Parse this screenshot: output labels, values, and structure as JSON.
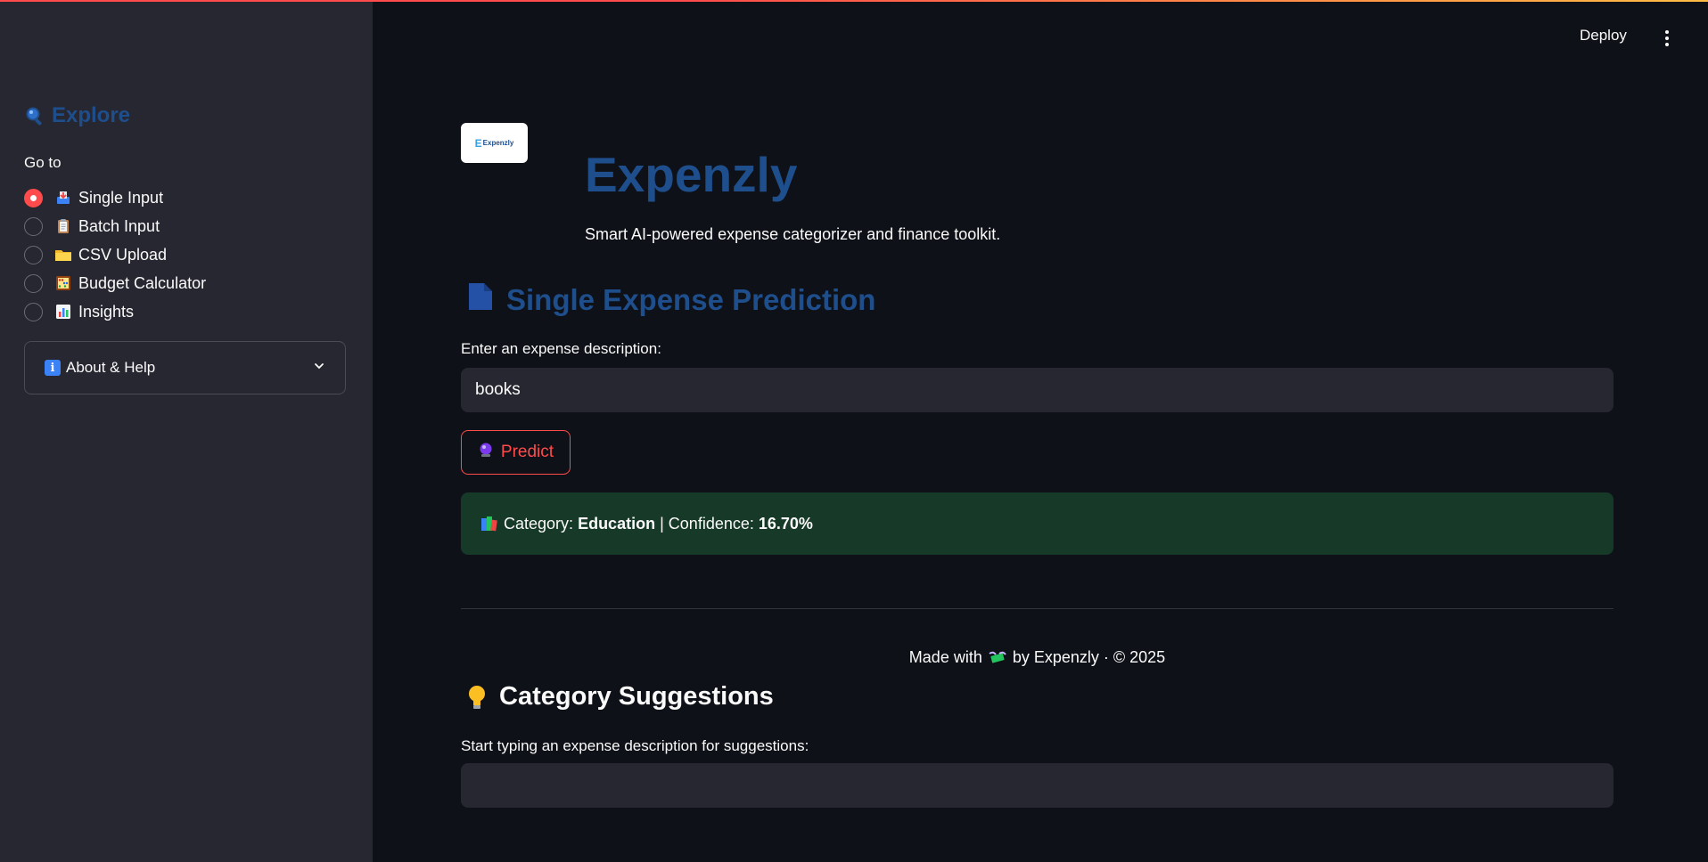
{
  "sidebar": {
    "title": "Explore",
    "title_icon": "magnifier-icon",
    "goto_label": "Go to",
    "items": [
      {
        "label": "Single Input",
        "icon": "inbox-tray-icon",
        "selected": true
      },
      {
        "label": "Batch Input",
        "icon": "clipboard-icon",
        "selected": false
      },
      {
        "label": "CSV Upload",
        "icon": "folder-icon",
        "selected": false
      },
      {
        "label": "Budget Calculator",
        "icon": "abacus-icon",
        "selected": false
      },
      {
        "label": "Insights",
        "icon": "bar-chart-icon",
        "selected": false
      }
    ],
    "expander": {
      "label": "About & Help",
      "icon": "info-icon"
    }
  },
  "header": {
    "deploy_label": "Deploy"
  },
  "main": {
    "logo_text": "Expenzly",
    "title": "Expenzly",
    "subtitle": "Smart AI-powered expense categorizer and finance toolkit.",
    "prediction_section": {
      "title": "Single Expense Prediction",
      "input_label": "Enter an expense description:",
      "input_value": "books",
      "button_label": "Predict",
      "result": {
        "category_prefix": "Category:",
        "category_value": "Education",
        "separator": "|",
        "confidence_prefix": "Confidence:",
        "confidence_value": "16.70%"
      }
    },
    "footer": {
      "made_with": "Made with",
      "by_text": "by Expenzly · © 2025"
    },
    "suggestions_section": {
      "title": "Category Suggestions",
      "input_label": "Start typing an expense description for suggestions:",
      "input_value": ""
    }
  },
  "colors": {
    "accent": "#ff4b4b",
    "brand_blue": "#1f4e8c",
    "success_bg": "#173928"
  }
}
